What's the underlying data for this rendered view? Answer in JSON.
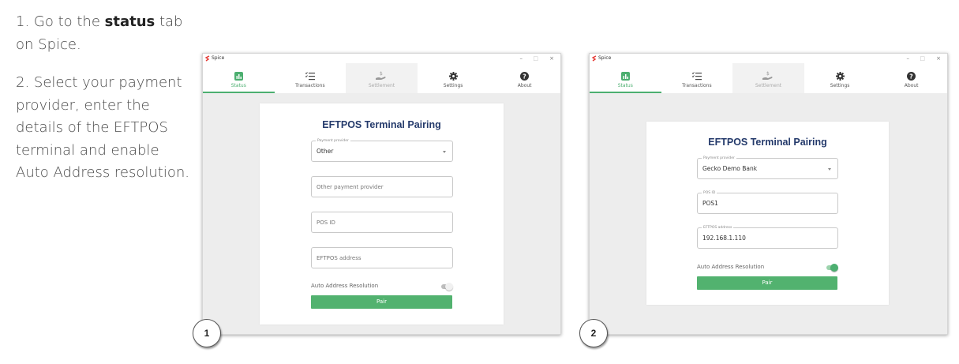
{
  "instructions": {
    "step1_prefix": "1. Go to the ",
    "step1_bold": "status",
    "step1_suffix": " tab on Spice.",
    "step2": "2. Select your payment provider, enter the details of the EFTPOS terminal and enable Auto Address resolution."
  },
  "app": {
    "title": "Spice",
    "window_controls": [
      "–",
      "□",
      "×"
    ],
    "nav": [
      {
        "label": "Status",
        "icon": "bar-chart-icon"
      },
      {
        "label": "Transactions",
        "icon": "list-check-icon"
      },
      {
        "label": "Settlement",
        "icon": "hand-coin-icon"
      },
      {
        "label": "Settings",
        "icon": "gear-icon"
      },
      {
        "label": "About",
        "icon": "question-circle-icon"
      }
    ],
    "accent_color": "#4caf70",
    "title_color": "#243a6b"
  },
  "screen1": {
    "badge": "1",
    "card_title": "EFTPOS Terminal Pairing",
    "provider_label": "Payment provider",
    "provider_value": "Other",
    "other_provider_placeholder": "Other payment provider",
    "pos_id_placeholder": "POS ID",
    "eftpos_address_placeholder": "EFTPOS address",
    "auto_address_label": "Auto Address Resolution",
    "auto_address_enabled": false,
    "pair_label": "Pair"
  },
  "screen2": {
    "badge": "2",
    "card_title": "EFTPOS Terminal Pairing",
    "provider_label": "Payment provider",
    "provider_value": "Gecko Demo Bank",
    "pos_id_label": "POS ID",
    "pos_id_value": "POS1",
    "eftpos_address_label": "EFTPOS address",
    "eftpos_address_value": "192.168.1.110",
    "auto_address_label": "Auto Address Resolution",
    "auto_address_enabled": true,
    "pair_label": "Pair"
  }
}
